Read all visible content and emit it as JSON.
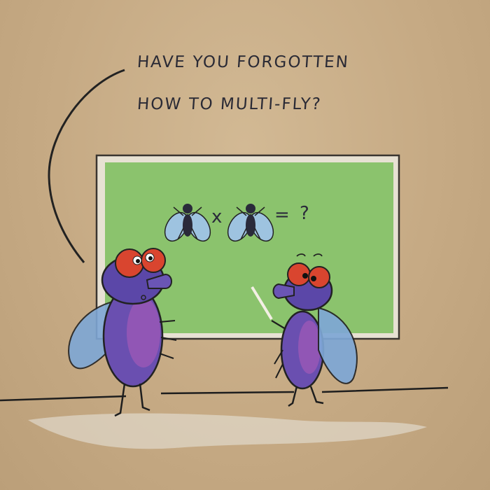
{
  "speech": {
    "line1": "HAVE YOU FORGOTTEN",
    "line2": "HOW TO MULTI-FLY?"
  },
  "chalkboard": {
    "times_symbol": "x",
    "equals_symbol": "=",
    "question_mark": "?"
  },
  "colors": {
    "paper": "#c9ae8a",
    "board_green": "#8fc46e",
    "board_frame": "#e7e1d3",
    "fly_body": "#6a4fb0",
    "fly_eye": "#d9452f",
    "wing": "#8fb8d8",
    "ink": "#2a2a35"
  }
}
